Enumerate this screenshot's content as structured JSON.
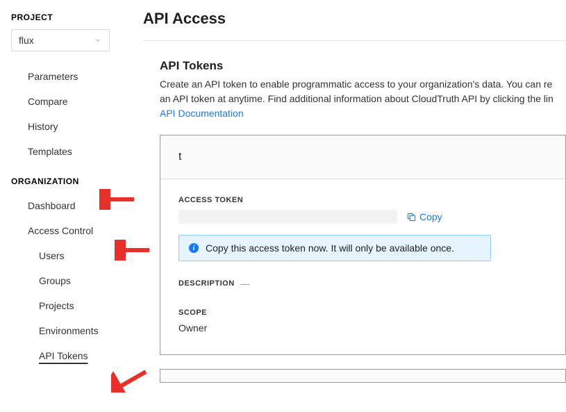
{
  "sidebar": {
    "project_header": "PROJECT",
    "project_selected": "flux",
    "project_items": [
      {
        "label": "Parameters"
      },
      {
        "label": "Compare"
      },
      {
        "label": "History"
      },
      {
        "label": "Templates"
      }
    ],
    "org_header": "ORGANIZATION",
    "org_items": [
      {
        "label": "Dashboard"
      },
      {
        "label": "Access Control",
        "sub": [
          {
            "label": "Users"
          },
          {
            "label": "Groups"
          },
          {
            "label": "Projects"
          },
          {
            "label": "Environments"
          },
          {
            "label": "API Tokens",
            "active": true
          }
        ]
      }
    ]
  },
  "page": {
    "title": "API Access",
    "tokens_heading": "API Tokens",
    "tokens_desc_1": "Create an API token to enable programmatic access to your organization's data. You can re",
    "tokens_desc_2": "an API token at anytime. Find additional information about CloudTruth API by clicking the lin",
    "docs_link": "API Documentation"
  },
  "token_card": {
    "name": "t",
    "access_token_label": "ACCESS TOKEN",
    "copy_label": "Copy",
    "alert_text": "Copy this access token now. It will only be available once.",
    "description_label": "DESCRIPTION",
    "scope_label": "SCOPE",
    "scope_value": "Owner"
  }
}
